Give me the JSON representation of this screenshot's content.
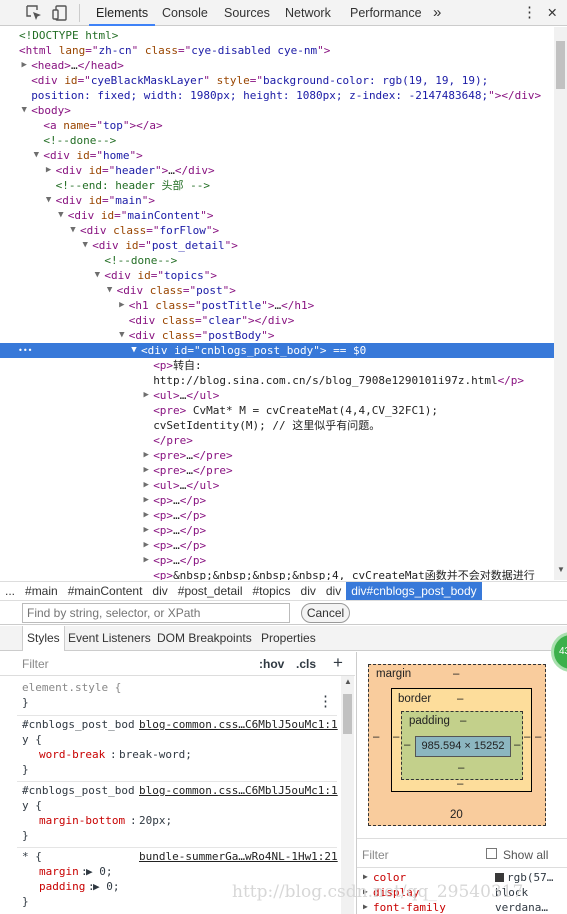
{
  "toolbar": {
    "tabs": [
      "Elements",
      "Console",
      "Sources",
      "Network",
      "Performance"
    ],
    "more": "»",
    "menu": "⋮",
    "close": "✕"
  },
  "dom_lines": [
    {
      "indent": 0,
      "tri": "",
      "parts": [
        [
          "comment",
          "<!DOCTYPE html>"
        ]
      ]
    },
    {
      "indent": 0,
      "tri": "",
      "parts": [
        [
          "tag",
          "<html "
        ],
        [
          "attr",
          "lang"
        ],
        [
          "tag",
          "=\""
        ],
        [
          "val",
          "zh-cn"
        ],
        [
          "tag",
          "\" "
        ],
        [
          "attr",
          "class"
        ],
        [
          "tag",
          "=\""
        ],
        [
          "val",
          "cye-disabled cye-nm"
        ],
        [
          "tag",
          "\">"
        ]
      ]
    },
    {
      "indent": 1,
      "tri": "▶",
      "parts": [
        [
          "tag",
          "<head>"
        ],
        [
          "txt",
          "…"
        ],
        [
          "tag",
          "</head>"
        ]
      ]
    },
    {
      "indent": 1,
      "tri": "",
      "parts": [
        [
          "tag",
          "<div "
        ],
        [
          "attr",
          "id"
        ],
        [
          "tag",
          "=\""
        ],
        [
          "val",
          "cyeBlackMaskLayer"
        ],
        [
          "tag",
          "\" "
        ],
        [
          "attr",
          "style"
        ],
        [
          "tag",
          "=\""
        ],
        [
          "val",
          "background-color: rgb(19, 19, 19);"
        ]
      ]
    },
    {
      "indent": 1,
      "tri": "",
      "parts": [
        [
          "val",
          "position: fixed; width: 1980px; height: 1080px; z-index: -2147483648;"
        ],
        [
          "tag",
          "\"></div>"
        ]
      ]
    },
    {
      "indent": 1,
      "tri": "▼",
      "parts": [
        [
          "tag",
          "<body>"
        ]
      ]
    },
    {
      "indent": 2,
      "tri": "",
      "parts": [
        [
          "tag",
          "<a "
        ],
        [
          "attr",
          "name"
        ],
        [
          "tag",
          "=\""
        ],
        [
          "val",
          "top"
        ],
        [
          "tag",
          "\"></a>"
        ]
      ]
    },
    {
      "indent": 2,
      "tri": "",
      "parts": [
        [
          "comment",
          "<!--done-->"
        ]
      ]
    },
    {
      "indent": 2,
      "tri": "▼",
      "parts": [
        [
          "tag",
          "<div "
        ],
        [
          "attr",
          "id"
        ],
        [
          "tag",
          "=\""
        ],
        [
          "val",
          "home"
        ],
        [
          "tag",
          "\">"
        ]
      ]
    },
    {
      "indent": 3,
      "tri": "▶",
      "parts": [
        [
          "tag",
          "<div "
        ],
        [
          "attr",
          "id"
        ],
        [
          "tag",
          "=\""
        ],
        [
          "val",
          "header"
        ],
        [
          "tag",
          "\">"
        ],
        [
          "txt",
          "…"
        ],
        [
          "tag",
          "</div>"
        ]
      ]
    },
    {
      "indent": 3,
      "tri": "",
      "parts": [
        [
          "comment",
          "<!--end: header 头部 -->"
        ]
      ]
    },
    {
      "indent": 3,
      "tri": "▼",
      "parts": [
        [
          "tag",
          "<div "
        ],
        [
          "attr",
          "id"
        ],
        [
          "tag",
          "=\""
        ],
        [
          "val",
          "main"
        ],
        [
          "tag",
          "\">"
        ]
      ]
    },
    {
      "indent": 4,
      "tri": "▼",
      "parts": [
        [
          "tag",
          "<div "
        ],
        [
          "attr",
          "id"
        ],
        [
          "tag",
          "=\""
        ],
        [
          "val",
          "mainContent"
        ],
        [
          "tag",
          "\">"
        ]
      ]
    },
    {
      "indent": 5,
      "tri": "▼",
      "parts": [
        [
          "tag",
          "<div "
        ],
        [
          "attr",
          "class"
        ],
        [
          "tag",
          "=\""
        ],
        [
          "val",
          "forFlow"
        ],
        [
          "tag",
          "\">"
        ]
      ]
    },
    {
      "indent": 6,
      "tri": "▼",
      "parts": [
        [
          "tag",
          "<div "
        ],
        [
          "attr",
          "id"
        ],
        [
          "tag",
          "=\""
        ],
        [
          "val",
          "post_detail"
        ],
        [
          "tag",
          "\">"
        ]
      ]
    },
    {
      "indent": 7,
      "tri": "",
      "parts": [
        [
          "comment",
          "<!--done-->"
        ]
      ]
    },
    {
      "indent": 7,
      "tri": "▼",
      "parts": [
        [
          "tag",
          "<div "
        ],
        [
          "attr",
          "id"
        ],
        [
          "tag",
          "=\""
        ],
        [
          "val",
          "topics"
        ],
        [
          "tag",
          "\">"
        ]
      ]
    },
    {
      "indent": 8,
      "tri": "▼",
      "parts": [
        [
          "tag",
          "<div "
        ],
        [
          "attr",
          "class"
        ],
        [
          "tag",
          "=\""
        ],
        [
          "val",
          "post"
        ],
        [
          "tag",
          "\">"
        ]
      ]
    },
    {
      "indent": 9,
      "tri": "▶",
      "parts": [
        [
          "tag",
          "<h1 "
        ],
        [
          "attr",
          "class"
        ],
        [
          "tag",
          "=\""
        ],
        [
          "val",
          "postTitle"
        ],
        [
          "tag",
          "\">"
        ],
        [
          "txt",
          "…"
        ],
        [
          "tag",
          "</h1>"
        ]
      ]
    },
    {
      "indent": 9,
      "tri": "",
      "parts": [
        [
          "tag",
          "<div "
        ],
        [
          "attr",
          "class"
        ],
        [
          "tag",
          "=\""
        ],
        [
          "val",
          "clear"
        ],
        [
          "tag",
          "\"></div>"
        ]
      ]
    },
    {
      "indent": 9,
      "tri": "▼",
      "parts": [
        [
          "tag",
          "<div "
        ],
        [
          "attr",
          "class"
        ],
        [
          "tag",
          "=\""
        ],
        [
          "val",
          "postBody"
        ],
        [
          "tag",
          "\">"
        ]
      ]
    },
    {
      "indent": 10,
      "tri": "▼",
      "sel": true,
      "parts": [
        [
          "tag",
          "<div "
        ],
        [
          "attr",
          "id"
        ],
        [
          "tag",
          "=\""
        ],
        [
          "val",
          "cnblogs_post_body"
        ],
        [
          "tag",
          "\">"
        ],
        [
          "txt",
          " == $0"
        ]
      ]
    },
    {
      "indent": 11,
      "tri": "",
      "parts": [
        [
          "tag",
          "<p>"
        ],
        [
          "txt",
          "转自:"
        ]
      ]
    },
    {
      "indent": 11,
      "tri": "",
      "parts": [
        [
          "txt",
          "http://blog.sina.com.cn/s/blog_7908e1290101i97z.html"
        ],
        [
          "tag",
          "</p>"
        ]
      ]
    },
    {
      "indent": 11,
      "tri": "▶",
      "parts": [
        [
          "tag",
          "<ul>"
        ],
        [
          "txt",
          "…"
        ],
        [
          "tag",
          "</ul>"
        ]
      ]
    },
    {
      "indent": 11,
      "tri": "",
      "parts": [
        [
          "tag",
          "<pre>"
        ],
        [
          "txt",
          " CvMat* M = cvCreateMat(4,4,CV_32FC1);"
        ]
      ]
    },
    {
      "indent": 11,
      "tri": "",
      "parts": [
        [
          "txt",
          "cvSetIdentity(M); // 这里似乎有问题。"
        ]
      ]
    },
    {
      "indent": 11,
      "tri": "",
      "parts": [
        [
          "tag",
          "</pre>"
        ]
      ]
    },
    {
      "indent": 11,
      "tri": "▶",
      "parts": [
        [
          "tag",
          "<pre>"
        ],
        [
          "txt",
          "…"
        ],
        [
          "tag",
          "</pre>"
        ]
      ]
    },
    {
      "indent": 11,
      "tri": "▶",
      "parts": [
        [
          "tag",
          "<pre>"
        ],
        [
          "txt",
          "…"
        ],
        [
          "tag",
          "</pre>"
        ]
      ]
    },
    {
      "indent": 11,
      "tri": "▶",
      "parts": [
        [
          "tag",
          "<ul>"
        ],
        [
          "txt",
          "…"
        ],
        [
          "tag",
          "</ul>"
        ]
      ]
    },
    {
      "indent": 11,
      "tri": "▶",
      "parts": [
        [
          "tag",
          "<p>"
        ],
        [
          "txt",
          "…"
        ],
        [
          "tag",
          "</p>"
        ]
      ]
    },
    {
      "indent": 11,
      "tri": "▶",
      "parts": [
        [
          "tag",
          "<p>"
        ],
        [
          "txt",
          "…"
        ],
        [
          "tag",
          "</p>"
        ]
      ]
    },
    {
      "indent": 11,
      "tri": "▶",
      "parts": [
        [
          "tag",
          "<p>"
        ],
        [
          "txt",
          "…"
        ],
        [
          "tag",
          "</p>"
        ]
      ]
    },
    {
      "indent": 11,
      "tri": "▶",
      "parts": [
        [
          "tag",
          "<p>"
        ],
        [
          "txt",
          "…"
        ],
        [
          "tag",
          "</p>"
        ]
      ]
    },
    {
      "indent": 11,
      "tri": "▶",
      "parts": [
        [
          "tag",
          "<p>"
        ],
        [
          "txt",
          "…"
        ],
        [
          "tag",
          "</p>"
        ]
      ]
    },
    {
      "indent": 11,
      "tri": "",
      "parts": [
        [
          "tag",
          "<p>"
        ],
        [
          "txt",
          "&nbsp;&nbsp;&nbsp;&nbsp;4, cvCreateMat函数并不会对数据进行"
        ]
      ]
    }
  ],
  "breadcrumbs": [
    "...",
    "#main",
    "#mainContent",
    "div",
    "#post_detail",
    "#topics",
    "div",
    "div",
    "div#cnblogs_post_body"
  ],
  "search": {
    "placeholder": "Find by string, selector, or XPath",
    "cancel": "Cancel"
  },
  "subtabs": [
    "Styles",
    "Event Listeners",
    "DOM Breakpoints",
    "Properties"
  ],
  "styles": {
    "filter_placeholder": "Filter",
    "hov": ":hov",
    "cls": ".cls",
    "plus": "+",
    "element_style_open": "element.style {",
    "element_style_close": "}",
    "rule1": {
      "selector_a": "#cnblogs_post_bod",
      "selector_b": "y {",
      "source": "blog-common.css…C6MblJ5ouMc1:1",
      "prop": "word-break",
      "value": "break-word;"
    },
    "rule2": {
      "selector_a": "#cnblogs_post_bod",
      "selector_b": "y {",
      "source": "blog-common.css…C6MblJ5ouMc1:1",
      "prop": "margin-bottom",
      "value": "20px;"
    },
    "rule3": {
      "selector": "* {",
      "source": "bundle-summerGa…wRo4NL-1Hw1:21",
      "props": [
        [
          "margin",
          "▶ 0;"
        ],
        [
          "padding",
          "▶ 0;"
        ]
      ]
    },
    "close": "}"
  },
  "boxmodel": {
    "margin_label": "margin",
    "margin_top": "–",
    "margin_bottom": "20",
    "margin_left": "–",
    "margin_right": "–",
    "border_label": "border",
    "border_top": "–",
    "border_bottom": "–",
    "border_left": "–",
    "border_right": "–",
    "padding_label": "padding",
    "padding_top": "–",
    "padding_bottom": "–",
    "padding_left": "–",
    "padding_right": "–",
    "content": "985.594 × 15252"
  },
  "computed": {
    "filter_placeholder": "Filter",
    "show_all": "Show all",
    "rows": [
      [
        "color",
        "rgb(57…"
      ],
      [
        "display",
        "block"
      ],
      [
        "font-family",
        "verdana…"
      ]
    ]
  },
  "badge": "43",
  "watermark": "http://blog.csdn.net/qq_29540317"
}
